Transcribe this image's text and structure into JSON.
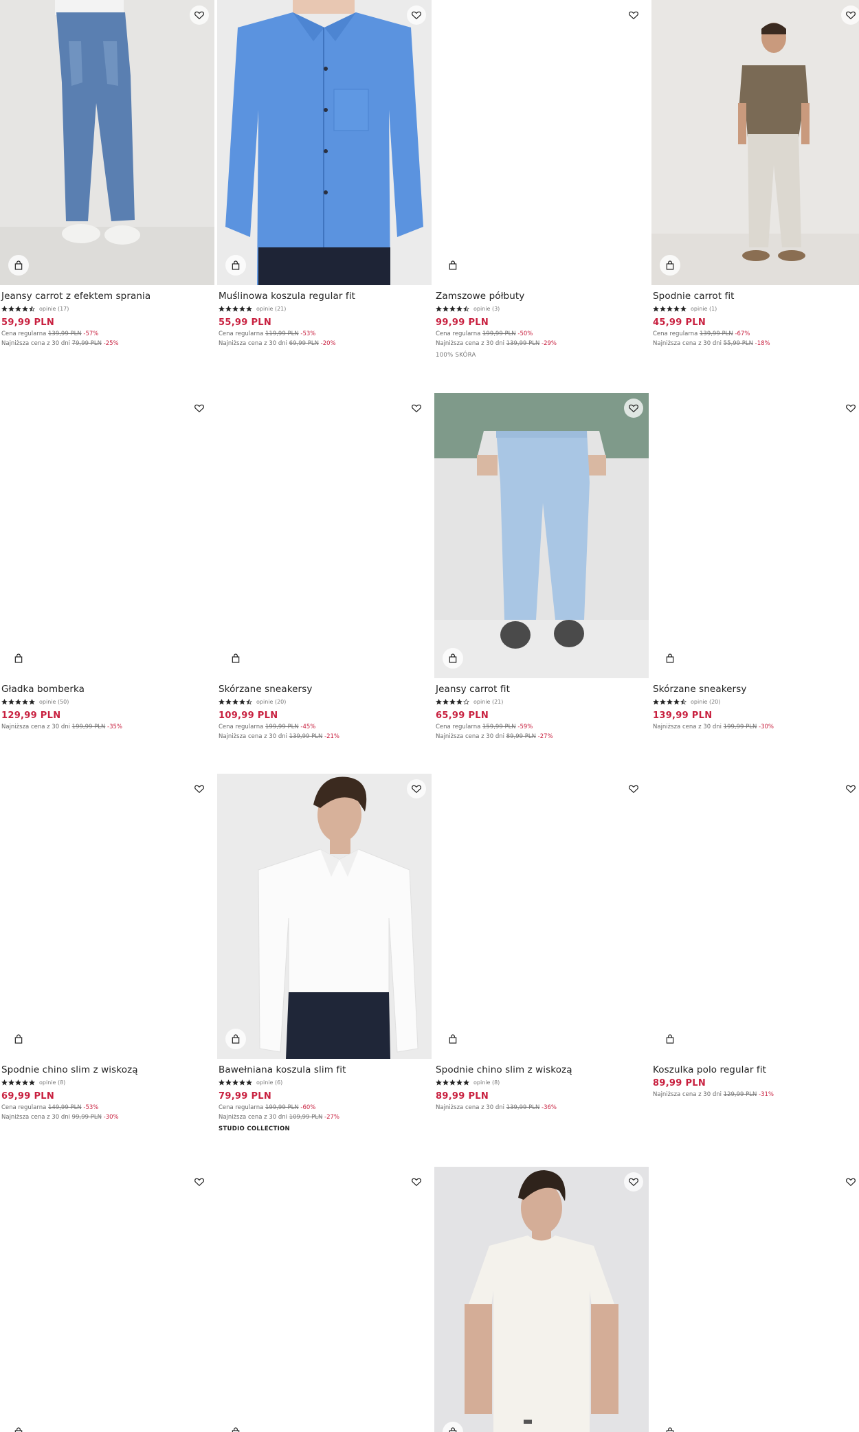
{
  "labels": {
    "regular": "Cena regularna",
    "lowest": "Najniższa cena z 30 dni"
  },
  "products": [
    {
      "title": "Jeansy carrot z efektem sprania",
      "stars": 4.5,
      "reviews": "opinie (17)",
      "price": "59,99 PLN",
      "regular_price": "139,99 PLN",
      "regular_discount": "-57%",
      "lowest_price": "79,99 PLN",
      "lowest_discount": "-25%",
      "image": "jeans-photo"
    },
    {
      "title": "Muślinowa koszula regular fit",
      "stars": 5,
      "reviews": "opinie (21)",
      "price": "55,99 PLN",
      "regular_price": "119,99 PLN",
      "regular_discount": "-53%",
      "lowest_price": "69,99 PLN",
      "lowest_discount": "-20%",
      "image": "blue-shirt-photo"
    },
    {
      "title": "Zamszowe półbuty",
      "stars": 4.5,
      "reviews": "opinie (3)",
      "price": "99,99 PLN",
      "regular_price": "199,99 PLN",
      "regular_discount": "-50%",
      "lowest_price": "139,99 PLN",
      "lowest_discount": "-29%",
      "tag": "100% SKÓRA"
    },
    {
      "title": "Spodnie carrot fit",
      "stars": 5,
      "reviews": "opinie (1)",
      "price": "45,99 PLN",
      "regular_price": "139,99 PLN",
      "regular_discount": "-67%",
      "lowest_price": "55,99 PLN",
      "lowest_discount": "-18%",
      "image": "carrot-pants-photo"
    },
    {
      "title": "Gładka bomberka",
      "stars": 5,
      "reviews": "opinie (50)",
      "price": "129,99 PLN",
      "lowest_price": "199,99 PLN",
      "lowest_discount": "-35%"
    },
    {
      "title": "Skórzane sneakersy",
      "stars": 4.5,
      "reviews": "opinie (20)",
      "price": "109,99 PLN",
      "regular_price": "199,99 PLN",
      "regular_discount": "-45%",
      "lowest_price": "139,99 PLN",
      "lowest_discount": "-21%"
    },
    {
      "title": "Jeansy carrot fit",
      "stars": 4,
      "reviews": "opinie (21)",
      "price": "65,99 PLN",
      "regular_price": "159,99 PLN",
      "regular_discount": "-59%",
      "lowest_price": "89,99 PLN",
      "lowest_discount": "-27%",
      "image": "light-jeans-photo"
    },
    {
      "title": "Skórzane sneakersy",
      "stars": 4.5,
      "reviews": "opinie (20)",
      "price": "139,99 PLN",
      "lowest_price": "199,99 PLN",
      "lowest_discount": "-30%"
    },
    {
      "title": "Spodnie chino slim z wiskozą",
      "stars": 5,
      "reviews": "opinie (8)",
      "price": "69,99 PLN",
      "regular_price": "149,99 PLN",
      "regular_discount": "-53%",
      "lowest_price": "99,99 PLN",
      "lowest_discount": "-30%"
    },
    {
      "title": "Bawełniana koszula slim fit",
      "stars": 5,
      "reviews": "opinie (6)",
      "price": "79,99 PLN",
      "regular_price": "199,99 PLN",
      "regular_discount": "-60%",
      "lowest_price": "109,99 PLN",
      "lowest_discount": "-27%",
      "tag": "STUDIO COLLECTION",
      "image": "white-shirt-photo"
    },
    {
      "title": "Spodnie chino slim z wiskozą",
      "stars": 5,
      "reviews": "opinie (8)",
      "price": "89,99 PLN",
      "lowest_price": "139,99 PLN",
      "lowest_discount": "-36%"
    },
    {
      "title": "Koszulka polo regular fit",
      "price": "89,99 PLN",
      "lowest_price": "129,99 PLN",
      "lowest_discount": "-31%"
    },
    {
      "image": "blank"
    },
    {
      "image": "blank"
    },
    {
      "image": "tshirt-photo"
    },
    {
      "image": "blank"
    }
  ],
  "icons": {
    "wishlist": "heart-icon",
    "cart": "shopping-bag-icon",
    "star": "star-icon"
  },
  "colors": {
    "price": "#c8203f",
    "text": "#222222",
    "muted": "#666666"
  }
}
